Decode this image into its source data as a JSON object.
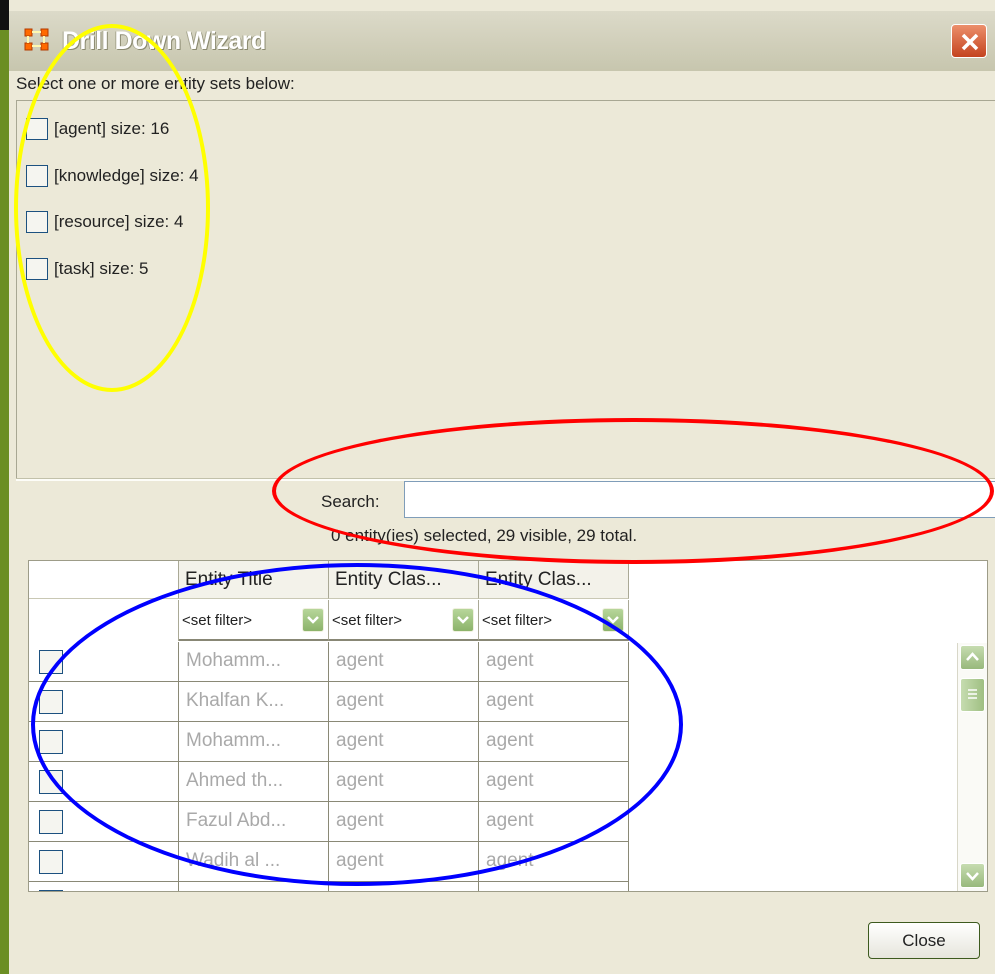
{
  "window": {
    "title": "Drill Down Wizard",
    "accent_color": "#6b8e23",
    "close_icon": "close-icon"
  },
  "instruction": "Select one or more entity sets below:",
  "entity_sets": [
    {
      "label": "[agent] size: 16",
      "checked": false
    },
    {
      "label": "[knowledge] size: 4",
      "checked": false
    },
    {
      "label": "[resource] size: 4",
      "checked": false
    },
    {
      "label": "[task] size: 5",
      "checked": false
    }
  ],
  "search": {
    "label": "Search:",
    "value": ""
  },
  "status": "0 entity(ies) selected, 29 visible, 29 total.",
  "table": {
    "columns": [
      "Entity Title",
      "Entity Clas...",
      "Entity Clas..."
    ],
    "filter_placeholder": "<set filter>",
    "rows": [
      [
        "Mohamm...",
        "agent",
        "agent"
      ],
      [
        "Khalfan K...",
        "agent",
        "agent"
      ],
      [
        "Mohamm...",
        "agent",
        "agent"
      ],
      [
        "Ahmed th...",
        "agent",
        "agent"
      ],
      [
        "Fazul Abd...",
        "agent",
        "agent"
      ],
      [
        "Wadih al ...",
        "agent",
        "agent"
      ]
    ]
  },
  "footer": {
    "close_label": "Close"
  },
  "annotations": {
    "yellow": "#ffff00",
    "red": "#ff0000",
    "blue": "#0000ff"
  }
}
